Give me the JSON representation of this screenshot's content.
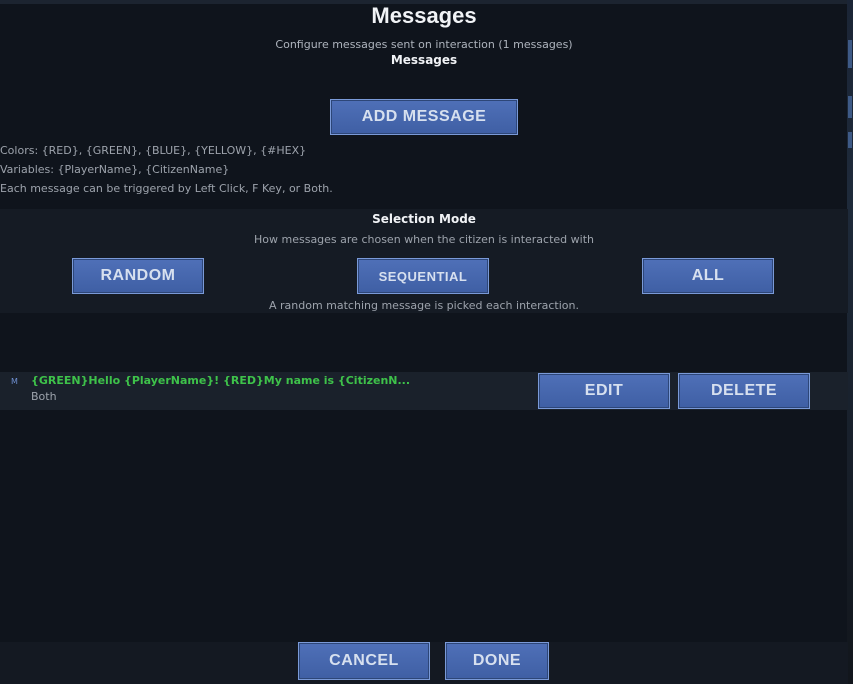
{
  "dialog": {
    "title": "Messages",
    "subtitle": "Configure messages sent on interaction (1 messages)",
    "section_label": "Messages",
    "add_button": "ADD MESSAGE"
  },
  "info": {
    "colors_line": "Colors: {RED}, {GREEN}, {BLUE}, {YELLOW}, {#HEX}",
    "variables_line": "Variables: {PlayerName}, {CitizenName}",
    "trigger_line": "Each message can be triggered by Left Click, F Key, or Both."
  },
  "selection": {
    "title": "Selection Mode",
    "description": "How messages are chosen when the citizen is interacted with",
    "modes": [
      "RANDOM",
      "SEQUENTIAL",
      "ALL"
    ],
    "note": "A random matching message is picked each interaction."
  },
  "messages": [
    {
      "marker": "M",
      "text": "{GREEN}Hello {PlayerName}! {RED}My name is {CitizenN...",
      "trigger": "Both",
      "edit_label": "EDIT",
      "delete_label": "DELETE"
    }
  ],
  "footer": {
    "cancel_label": "CANCEL",
    "done_label": "DONE"
  },
  "colors": {
    "accent_button": "#4a6bb3",
    "message_green": "#3ec24a",
    "background": "#0f141c"
  }
}
